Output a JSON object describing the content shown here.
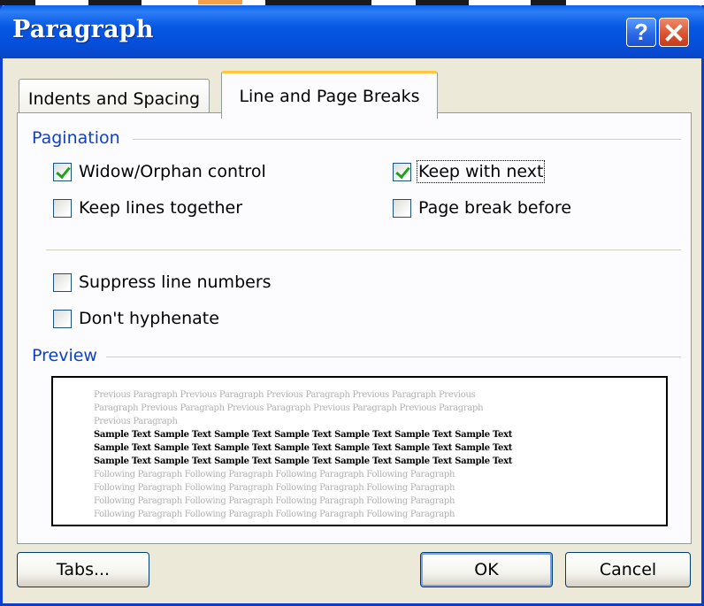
{
  "dialog": {
    "title": "Paragraph",
    "help_symbol": "?",
    "close_symbol": "close"
  },
  "tabs": [
    {
      "label": "Indents and Spacing",
      "active": false
    },
    {
      "label": "Line and Page Breaks",
      "active": true
    }
  ],
  "pagination": {
    "heading": "Pagination",
    "widow_orphan": {
      "label": "Widow/Orphan control",
      "checked": true
    },
    "keep_lines": {
      "label": "Keep lines together",
      "checked": false
    },
    "keep_with_next": {
      "label": "Keep with next",
      "checked": true
    },
    "page_break_before": {
      "label": "Page break before",
      "checked": false
    }
  },
  "formatting": {
    "suppress_line_numbers": {
      "label": "Suppress line numbers",
      "checked": false
    },
    "dont_hyphenate": {
      "label": "Don't hyphenate",
      "checked": false
    }
  },
  "preview": {
    "heading": "Preview",
    "previous_lines": [
      "Previous Paragraph Previous Paragraph Previous Paragraph Previous Paragraph Previous",
      "Paragraph Previous Paragraph Previous Paragraph Previous Paragraph Previous Paragraph",
      "Previous Paragraph"
    ],
    "sample_lines": [
      "Sample Text Sample Text Sample Text Sample Text Sample Text Sample Text Sample Text",
      "Sample Text Sample Text Sample Text Sample Text Sample Text Sample Text Sample Text",
      "Sample Text Sample Text Sample Text Sample Text Sample Text Sample Text Sample Text"
    ],
    "following_lines": [
      "Following Paragraph Following Paragraph Following Paragraph Following Paragraph",
      "Following Paragraph Following Paragraph Following Paragraph Following Paragraph",
      "Following Paragraph Following Paragraph Following Paragraph Following Paragraph",
      "Following Paragraph Following Paragraph Following Paragraph Following Paragraph"
    ]
  },
  "buttons": {
    "tabs": "Tabs...",
    "ok": "OK",
    "cancel": "Cancel"
  },
  "colors": {
    "titlebar": "#0450dc",
    "section_heading": "#1040c8",
    "dialog_bg": "#ece9d8",
    "active_tab_accent": "#ffc83c",
    "check_mark": "#21a121"
  }
}
